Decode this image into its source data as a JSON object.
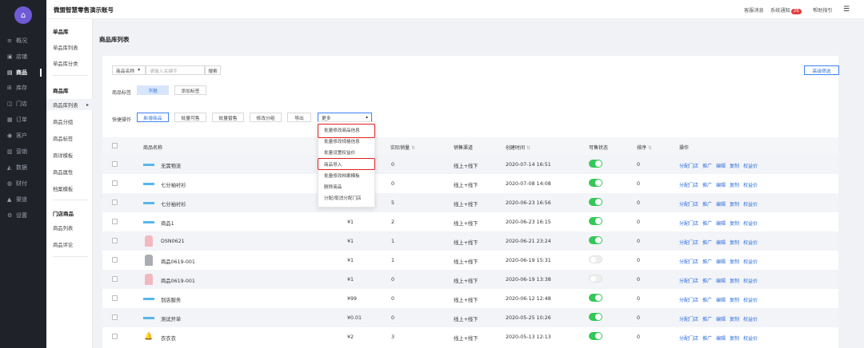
{
  "app": {
    "title": "微盟智慧零售演示账号"
  },
  "topbar": {
    "msg": "客服消息",
    "notice": "系统通知",
    "notice_count": "26",
    "help": "帮助指引"
  },
  "nav": [
    {
      "icon": "≡",
      "label": "概况"
    },
    {
      "icon": "▣",
      "label": "店铺"
    },
    {
      "icon": "▤",
      "label": "商品"
    },
    {
      "icon": "⊞",
      "label": "库存"
    },
    {
      "icon": "◫",
      "label": "门店"
    },
    {
      "icon": "▦",
      "label": "订单"
    },
    {
      "icon": "◉",
      "label": "客户"
    },
    {
      "icon": "▥",
      "label": "营销"
    },
    {
      "icon": "◭",
      "label": "数据"
    },
    {
      "icon": "◍",
      "label": "财付"
    },
    {
      "icon": "▲",
      "label": "渠道"
    },
    {
      "icon": "⚙",
      "label": "设置"
    }
  ],
  "subnav": {
    "group1": "单品库",
    "g1_items": [
      "单品库列表",
      "单品库分类"
    ],
    "group2": "商品库",
    "g2_items": [
      "商品库列表",
      "商品分组",
      "商品标签",
      "商详模板",
      "商品属性",
      "档案模板"
    ],
    "group3": "门店商品",
    "g3_items": [
      "商品列表",
      "商品评论"
    ]
  },
  "page": {
    "title": "商品库列表"
  },
  "filter": {
    "field": "商品名称",
    "placeholder": "请输入关键字",
    "search": "搜索",
    "advanced": "高级筛选"
  },
  "tags": {
    "label": "商品标签",
    "all": "不限",
    "add": "添加标签"
  },
  "quick": {
    "label": "快捷操作",
    "buttons": [
      "新增商品",
      "批量可售",
      "批量替售",
      "修改分组",
      "导出"
    ],
    "more": "更多"
  },
  "dropdown": [
    "批量修改商品信息",
    "批量修改规格信息",
    "批量设置权益价",
    "商品导入",
    "批量修改档案模板",
    "删除商品",
    "分配/取消分配门店"
  ],
  "table": {
    "headers": {
      "name": "商品名称",
      "sold": "实际销量",
      "channel": "销售渠道",
      "created": "创建时间",
      "status": "可售状态",
      "sort": "排序",
      "ops": "操作"
    },
    "actions": [
      "分配门店",
      "推广",
      "编辑",
      "复制",
      "权益价"
    ],
    "rows": [
      {
        "name": "无需物流",
        "price": "",
        "sold": "0",
        "channel": "线上+线下",
        "created": "2020-07-14 16:51",
        "on": true,
        "sort": "0",
        "thumb": "weimob"
      },
      {
        "name": "七分袖衬衫",
        "price": "",
        "sold": "0",
        "channel": "线上+线下",
        "created": "2020-07-08 14:08",
        "on": true,
        "sort": "0",
        "thumb": "weimob"
      },
      {
        "name": "七分袖衬衫",
        "price": "",
        "sold": "5",
        "channel": "线上+线下",
        "created": "2020-06-23 16:56",
        "on": true,
        "sort": "0",
        "thumb": "weimob"
      },
      {
        "name": "商品1",
        "price": "¥1",
        "sold": "2",
        "channel": "线上+线下",
        "created": "2020-06-23 16:15",
        "on": true,
        "sort": "0",
        "thumb": "weimob"
      },
      {
        "name": "DSN0621",
        "price": "¥1",
        "sold": "1",
        "channel": "线上+线下",
        "created": "2020-06-21 23:24",
        "on": true,
        "sort": "0",
        "thumb": "pink"
      },
      {
        "name": "商品0619-001",
        "price": "¥1",
        "sold": "1",
        "channel": "线上+线下",
        "created": "2020-06-19 15:31",
        "on": false,
        "sort": "0",
        "thumb": "gray"
      },
      {
        "name": "商品0619-001",
        "price": "¥1",
        "sold": "0",
        "channel": "线上+线下",
        "created": "2020-06-19 13:38",
        "on": false,
        "sort": "0",
        "thumb": "pink"
      },
      {
        "name": "到店服务",
        "price": "¥99",
        "sold": "0",
        "channel": "线上+线下",
        "created": "2020-06-12 12:48",
        "on": true,
        "sort": "0",
        "thumb": "weimob"
      },
      {
        "name": "测试开单",
        "price": "¥0.01",
        "sold": "0",
        "channel": "线上+线下",
        "created": "2020-05-25 10:26",
        "on": true,
        "sort": "0",
        "thumb": "weimob"
      },
      {
        "name": "衣衣衣",
        "price": "¥2",
        "sold": "3",
        "channel": "线上+线下",
        "created": "2020-05-13 12:13",
        "on": true,
        "sort": "0",
        "thumb": "bell"
      }
    ]
  }
}
